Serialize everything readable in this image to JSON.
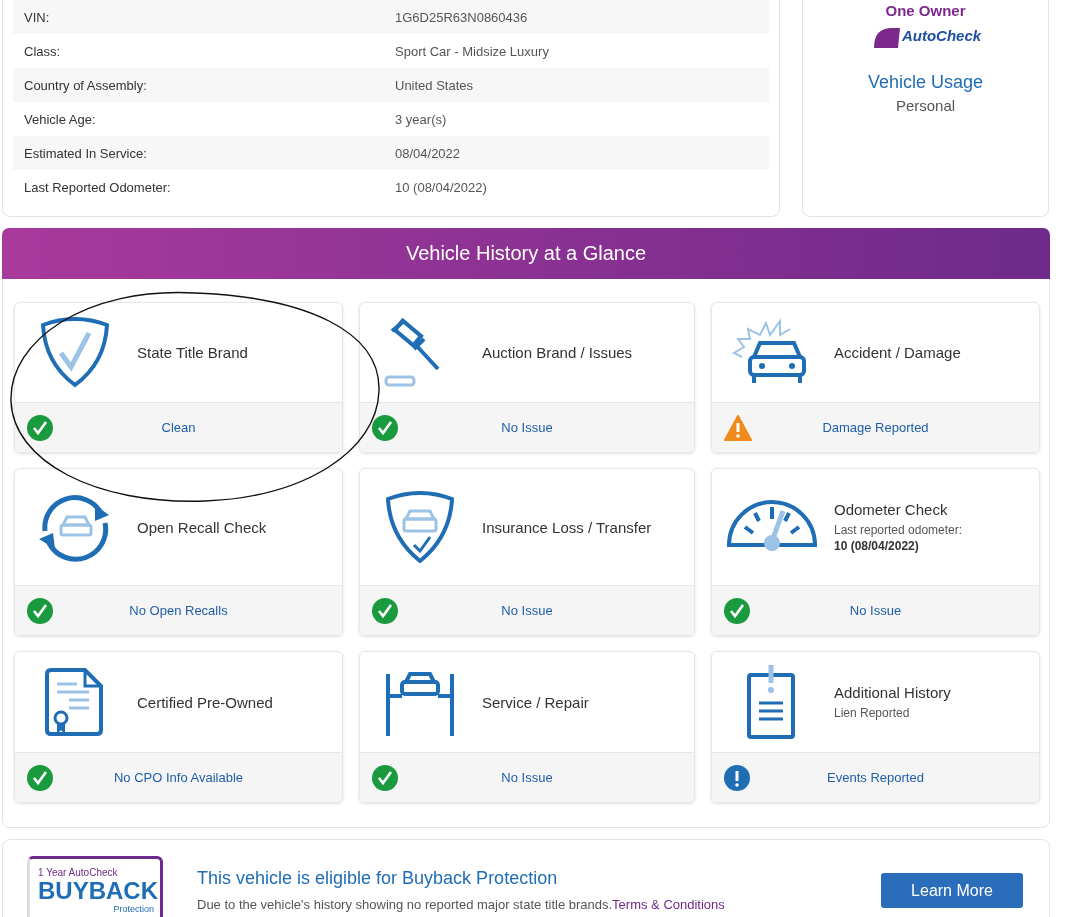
{
  "specs": [
    {
      "label": "VIN:",
      "value": "1G6D25R63N0860436"
    },
    {
      "label": "Class:",
      "value": "Sport Car - Midsize Luxury"
    },
    {
      "label": "Country of Assembly:",
      "value": "United States"
    },
    {
      "label": "Vehicle Age:",
      "value": "3 year(s)"
    },
    {
      "label": "Estimated In Service:",
      "value": "08/04/2022"
    },
    {
      "label": "Last Reported Odometer:",
      "value": "10 (08/04/2022)"
    }
  ],
  "owner_card": {
    "badge_title": "One Owner",
    "badge_brand": "AutoCheck",
    "usage_label": "Vehicle Usage",
    "usage_value": "Personal"
  },
  "glance": {
    "title": "Vehicle History at a Glance",
    "items": [
      {
        "title": "State Title Brand",
        "kind": "ok",
        "result": "Clean"
      },
      {
        "title": "Auction Brand / Issues",
        "kind": "ok",
        "result": "No Issue"
      },
      {
        "title": "Accident / Damage",
        "kind": "warning",
        "result": "Damage Reported"
      },
      {
        "title": "Open Recall Check",
        "kind": "ok",
        "result": "No Open Recalls"
      },
      {
        "title": "Insurance Loss / Transfer",
        "kind": "ok",
        "result": "No Issue"
      },
      {
        "title": "Odometer Check",
        "note": "Last reported odometer:",
        "note_value": "10 (08/04/2022)",
        "kind": "ok",
        "result": "No Issue"
      },
      {
        "title": "Certified Pre-Owned",
        "kind": "ok",
        "result": "No CPO Info Available"
      },
      {
        "title": "Service / Repair",
        "kind": "ok",
        "result": "No Issue"
      },
      {
        "title": "Additional History",
        "note": "Lien Reported",
        "kind": "info",
        "result": "Events Reported"
      }
    ]
  },
  "buyback": {
    "badge_top": "1 Year AutoCheck",
    "badge_main": "BUYBACK",
    "badge_sub": "Protection",
    "title": "This vehicle is eligible for Buyback Protection",
    "text": "Due to the vehicle's history showing no reported major state title brands.",
    "link": "Terms & Conditions",
    "button": "Learn More"
  }
}
